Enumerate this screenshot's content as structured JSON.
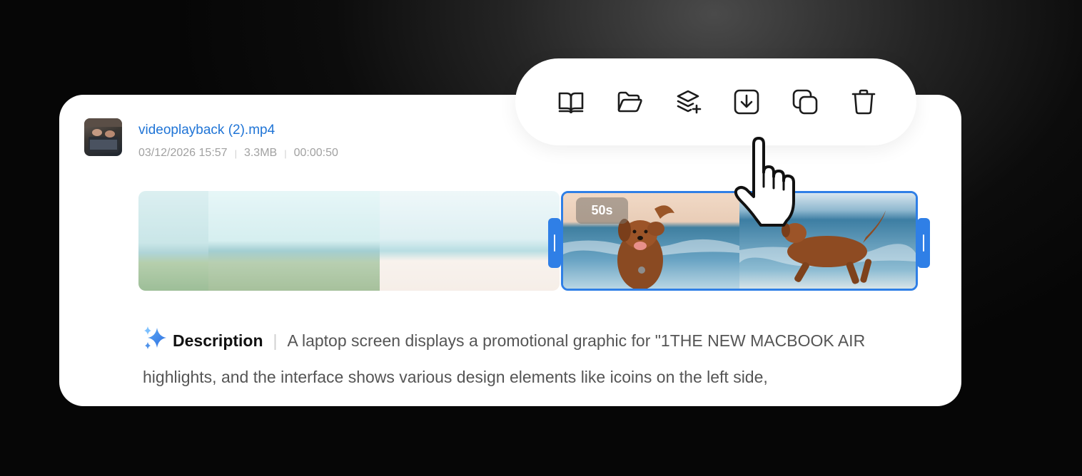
{
  "file": {
    "name": "videoplayback (2).mp4",
    "date": "03/12/2026 15:57",
    "size": "3.3MB",
    "duration": "00:00:50"
  },
  "toolbar": {
    "items": [
      {
        "icon": "book-open-icon"
      },
      {
        "icon": "folder-open-icon"
      },
      {
        "icon": "layers-add-icon"
      },
      {
        "icon": "download-icon"
      },
      {
        "icon": "copy-icon"
      },
      {
        "icon": "trash-icon"
      }
    ]
  },
  "timeline": {
    "selected_badge": "50s"
  },
  "description": {
    "label": "Description",
    "text": "A laptop screen displays a promotional graphic for \"1THE NEW MACBOOK AIR highlights, and the interface shows various design elements like icoins on the left side,"
  },
  "colors": {
    "accent": "#2f7fe6",
    "link": "#1f74d6",
    "card": "#ffffff",
    "background": "#0c0c0c"
  }
}
